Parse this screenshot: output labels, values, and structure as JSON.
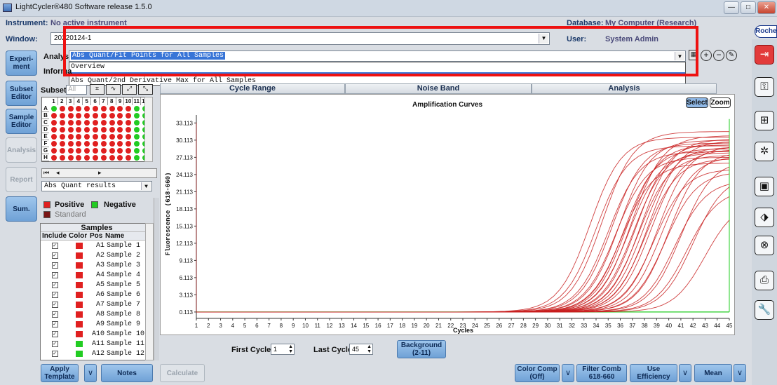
{
  "app": {
    "title": "LightCycler®480 Software release 1.5.0"
  },
  "window_buttons": {
    "minimize": "—",
    "maximize": "□",
    "close": "✕"
  },
  "header": {
    "instrument_label": "Instrument:",
    "instrument_value": "No active instrument",
    "database_label": "Database:",
    "database_value": "My Computer (Research)",
    "window_label": "Window:",
    "window_value": "20220124-1",
    "user_label": "User:",
    "user_value": "System Admin",
    "brand": "Roche"
  },
  "sidebar": {
    "items": [
      {
        "label": "Experi-ment",
        "enabled": true
      },
      {
        "label": "Subset Editor",
        "enabled": true
      },
      {
        "label": "Sample Editor",
        "enabled": true
      },
      {
        "label": "Analysis",
        "enabled": false
      },
      {
        "label": "Report",
        "enabled": false
      },
      {
        "label": "Sum.",
        "enabled": true
      }
    ]
  },
  "analysis": {
    "label": "Analysis",
    "selected": "Abs Quant/Fit Points for All Samples",
    "options": [
      "Overview",
      "Abs Quant/2nd Derivative Max for All Samples"
    ],
    "info_label": "Informa"
  },
  "subset": {
    "label": "Subset:",
    "value": "All"
  },
  "plate": {
    "cols": [
      "1",
      "2",
      "3",
      "4",
      "5",
      "6",
      "7",
      "8",
      "9",
      "10",
      "11",
      "12"
    ],
    "rows": [
      "A",
      "B",
      "C",
      "D",
      "E",
      "F",
      "G",
      "H"
    ]
  },
  "results_dropdown": "Abs Quant results",
  "legend": {
    "positive": "Positive",
    "negative": "Negative",
    "standard": "Standard"
  },
  "samples_table": {
    "title": "Samples",
    "headers": [
      "Include",
      "Color",
      "Pos",
      "Name"
    ],
    "rows": [
      {
        "color": "#e02020",
        "pos": "A1",
        "name": "Sample 1"
      },
      {
        "color": "#e02020",
        "pos": "A2",
        "name": "Sample 2"
      },
      {
        "color": "#e02020",
        "pos": "A3",
        "name": "Sample 3"
      },
      {
        "color": "#e02020",
        "pos": "A4",
        "name": "Sample 4"
      },
      {
        "color": "#e02020",
        "pos": "A5",
        "name": "Sample 5"
      },
      {
        "color": "#e02020",
        "pos": "A6",
        "name": "Sample 6"
      },
      {
        "color": "#e02020",
        "pos": "A7",
        "name": "Sample 7"
      },
      {
        "color": "#e02020",
        "pos": "A8",
        "name": "Sample 8"
      },
      {
        "color": "#e02020",
        "pos": "A9",
        "name": "Sample 9"
      },
      {
        "color": "#e02020",
        "pos": "A10",
        "name": "Sample 10"
      },
      {
        "color": "#22cc22",
        "pos": "A11",
        "name": "Sample 11"
      },
      {
        "color": "#22cc22",
        "pos": "A12",
        "name": "Sample 12"
      }
    ]
  },
  "tabs": {
    "cycle_range": "Cycle Range",
    "noise_band": "Noise Band",
    "analysis": "Analysis"
  },
  "chart_buttons": {
    "select": "Select",
    "zoom": "Zoom"
  },
  "chart_data": {
    "type": "line",
    "title": "Amplification Curves",
    "xlabel": "Cycles",
    "ylabel": "Fluorescence (618-660)",
    "x_ticks": [
      "1",
      "2",
      "3",
      "4",
      "5",
      "6",
      "7",
      "8",
      "9",
      "10",
      "11",
      "12",
      "13",
      "14",
      "15",
      "16",
      "17",
      "18",
      "19",
      "20",
      "21",
      "22",
      "23",
      "24",
      "25",
      "26",
      "27",
      "28",
      "29",
      "30",
      "31",
      "32",
      "33",
      "34",
      "35",
      "36",
      "37",
      "38",
      "39",
      "40",
      "41",
      "42",
      "43",
      "44",
      "45"
    ],
    "y_ticks": [
      "0.113",
      "3.113",
      "6.113",
      "9.113",
      "12.113",
      "15.113",
      "18.113",
      "21.113",
      "24.113",
      "27.113",
      "30.113",
      "33.113"
    ],
    "xlim": [
      1,
      45
    ],
    "ylim": [
      -1,
      34.5
    ],
    "series_color": "#c81e1e",
    "negative_color": "#22cc22",
    "curves": [
      {
        "c": 33.5,
        "plateau": 30.5
      },
      {
        "c": 34.0,
        "plateau": 29.0
      },
      {
        "c": 34.5,
        "plateau": 31.5
      },
      {
        "c": 35.0,
        "plateau": 28.0
      },
      {
        "c": 35.3,
        "plateau": 29.5
      },
      {
        "c": 35.6,
        "plateau": 27.0
      },
      {
        "c": 35.9,
        "plateau": 30.0
      },
      {
        "c": 36.1,
        "plateau": 26.0
      },
      {
        "c": 36.3,
        "plateau": 28.5
      },
      {
        "c": 36.5,
        "plateau": 29.2
      },
      {
        "c": 36.7,
        "plateau": 27.8
      },
      {
        "c": 36.9,
        "plateau": 30.8
      },
      {
        "c": 37.1,
        "plateau": 28.2
      },
      {
        "c": 37.3,
        "plateau": 29.6
      },
      {
        "c": 37.5,
        "plateau": 27.4
      },
      {
        "c": 37.7,
        "plateau": 30.2
      },
      {
        "c": 37.9,
        "plateau": 28.8
      },
      {
        "c": 38.1,
        "plateau": 26.8
      },
      {
        "c": 38.3,
        "plateau": 29.9
      },
      {
        "c": 38.5,
        "plateau": 28.4
      },
      {
        "c": 38.8,
        "plateau": 25.0
      },
      {
        "c": 39.1,
        "plateau": 29.0
      },
      {
        "c": 39.4,
        "plateau": 27.2
      },
      {
        "c": 39.7,
        "plateau": 24.5
      },
      {
        "c": 40.0,
        "plateau": 28.0
      },
      {
        "c": 40.5,
        "plateau": 23.0
      },
      {
        "c": 41.0,
        "plateau": 26.5
      },
      {
        "c": 41.5,
        "plateau": 21.5
      },
      {
        "c": 42.0,
        "plateau": 24.0
      },
      {
        "c": 43.0,
        "plateau": 19.5
      }
    ]
  },
  "cycles": {
    "first_label": "First Cycle",
    "first_value": "1",
    "last_label": "Last Cycle",
    "last_value": "45"
  },
  "background_button": "Background (2-11)",
  "bottom": {
    "apply_template": "Apply Template",
    "notes": "Notes",
    "calculate": "Calculate",
    "color_comp": "Color Comp (Off)",
    "filter_comb": "Filter Comb 618-660",
    "use_efficiency": "Use Efficiency",
    "mean": "Mean"
  }
}
